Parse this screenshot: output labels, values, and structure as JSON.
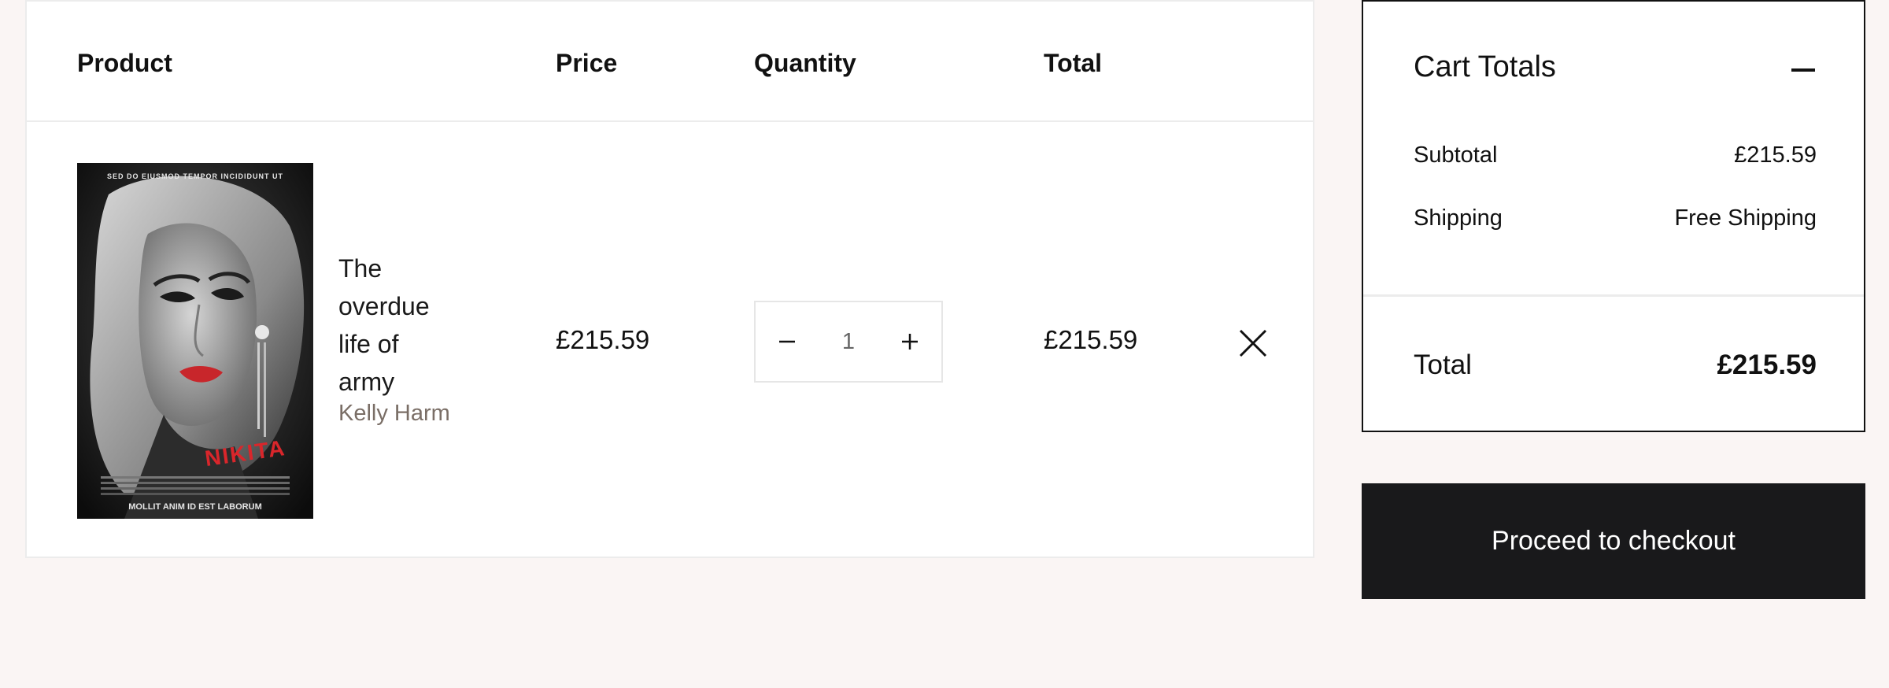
{
  "table": {
    "headers": {
      "product": "Product",
      "price": "Price",
      "quantity": "Quantity",
      "total": "Total"
    },
    "items": [
      {
        "title": "The overdue life of army",
        "author": "Kelly Harm",
        "price": "£215.59",
        "quantity": "1",
        "total": "£215.59",
        "cover": {
          "top_text": "SED DO EIUSMOD TEMPOR INCIDIDUNT UT",
          "name_text": "NIKITA",
          "bottom_text": "MOLLIT ANIM ID EST LABORUM",
          "accent_color": "#d9262b"
        }
      }
    ]
  },
  "totals": {
    "title": "Cart Totals",
    "subtotal_label": "Subtotal",
    "subtotal_value": "£215.59",
    "shipping_label": "Shipping",
    "shipping_value": "Free Shipping",
    "total_label": "Total",
    "total_value": "£215.59"
  },
  "checkout": {
    "label": "Proceed to checkout"
  },
  "icons": {
    "minus": "minus-icon",
    "plus": "plus-icon",
    "remove": "close-icon",
    "collapse": "collapse-icon"
  },
  "colors": {
    "page_background": "#faf5f4",
    "checkout_button": "#19191b",
    "author_text": "#7a6e66"
  }
}
